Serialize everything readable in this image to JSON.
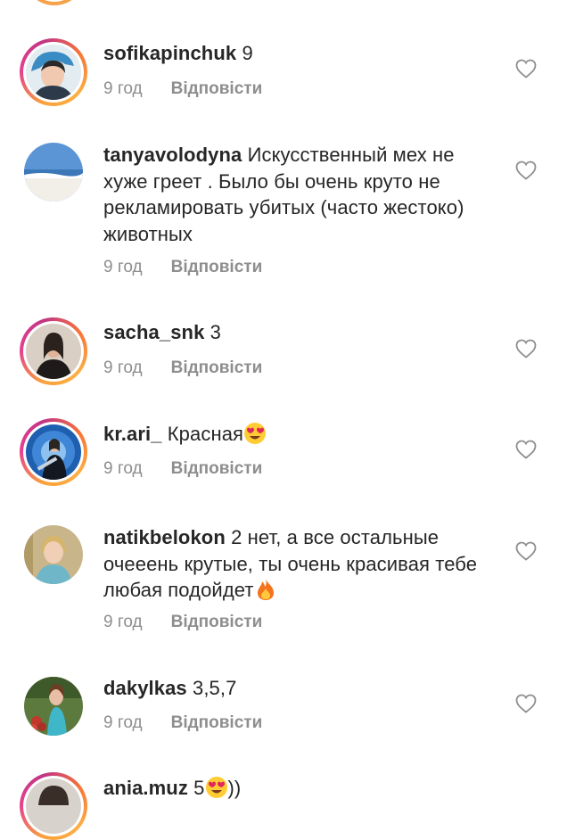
{
  "comments": [
    {
      "username": "sofikapinchuk",
      "text": "9",
      "time": "9 год",
      "reply": "Відповісти",
      "avatar": "avatar-girl-blue-hat",
      "story_ring": true
    },
    {
      "username": "tanyavolodyna",
      "text": "Искусственный мех не хуже греет . Было бы очень круто не рекламировать убитых (часто жестоко) животных",
      "time": "9 год",
      "reply": "Відповісти",
      "avatar": "avatar-beach-sky",
      "story_ring": false
    },
    {
      "username": "sacha_snk",
      "text": "3",
      "time": "9 год",
      "reply": "Відповісти",
      "avatar": "avatar-girl-dark",
      "story_ring": true
    },
    {
      "username": "kr.ari_",
      "text": "Красная",
      "emoji": "heart-eyes-emoji",
      "time": "9 год",
      "reply": "Відповісти",
      "avatar": "avatar-singer-stage",
      "story_ring": true
    },
    {
      "username": "natikbelokon",
      "text": "2 нет, а все остальные очееeнь крутые, ты очень красивая тебе любая подойдет",
      "emoji": "fire-emoji",
      "time": "9 год",
      "reply": "Відповісти",
      "avatar": "avatar-woman-blonde",
      "story_ring": false
    },
    {
      "username": "dakylkas",
      "text": "3,5,7",
      "time": "9 год",
      "reply": "Відповісти",
      "avatar": "avatar-girl-flowers",
      "story_ring": false
    },
    {
      "username": "ania.muz",
      "text": "5",
      "text_after": "))",
      "emoji": "heart-eyes-emoji",
      "avatar": "avatar-girl-partial",
      "story_ring": true
    }
  ],
  "colors": {
    "ring_start": "#f9a13b",
    "ring_end": "#c13584",
    "meta": "#8e8e8e",
    "text": "#262626"
  },
  "icons": {
    "like": "heart-outline-icon"
  }
}
